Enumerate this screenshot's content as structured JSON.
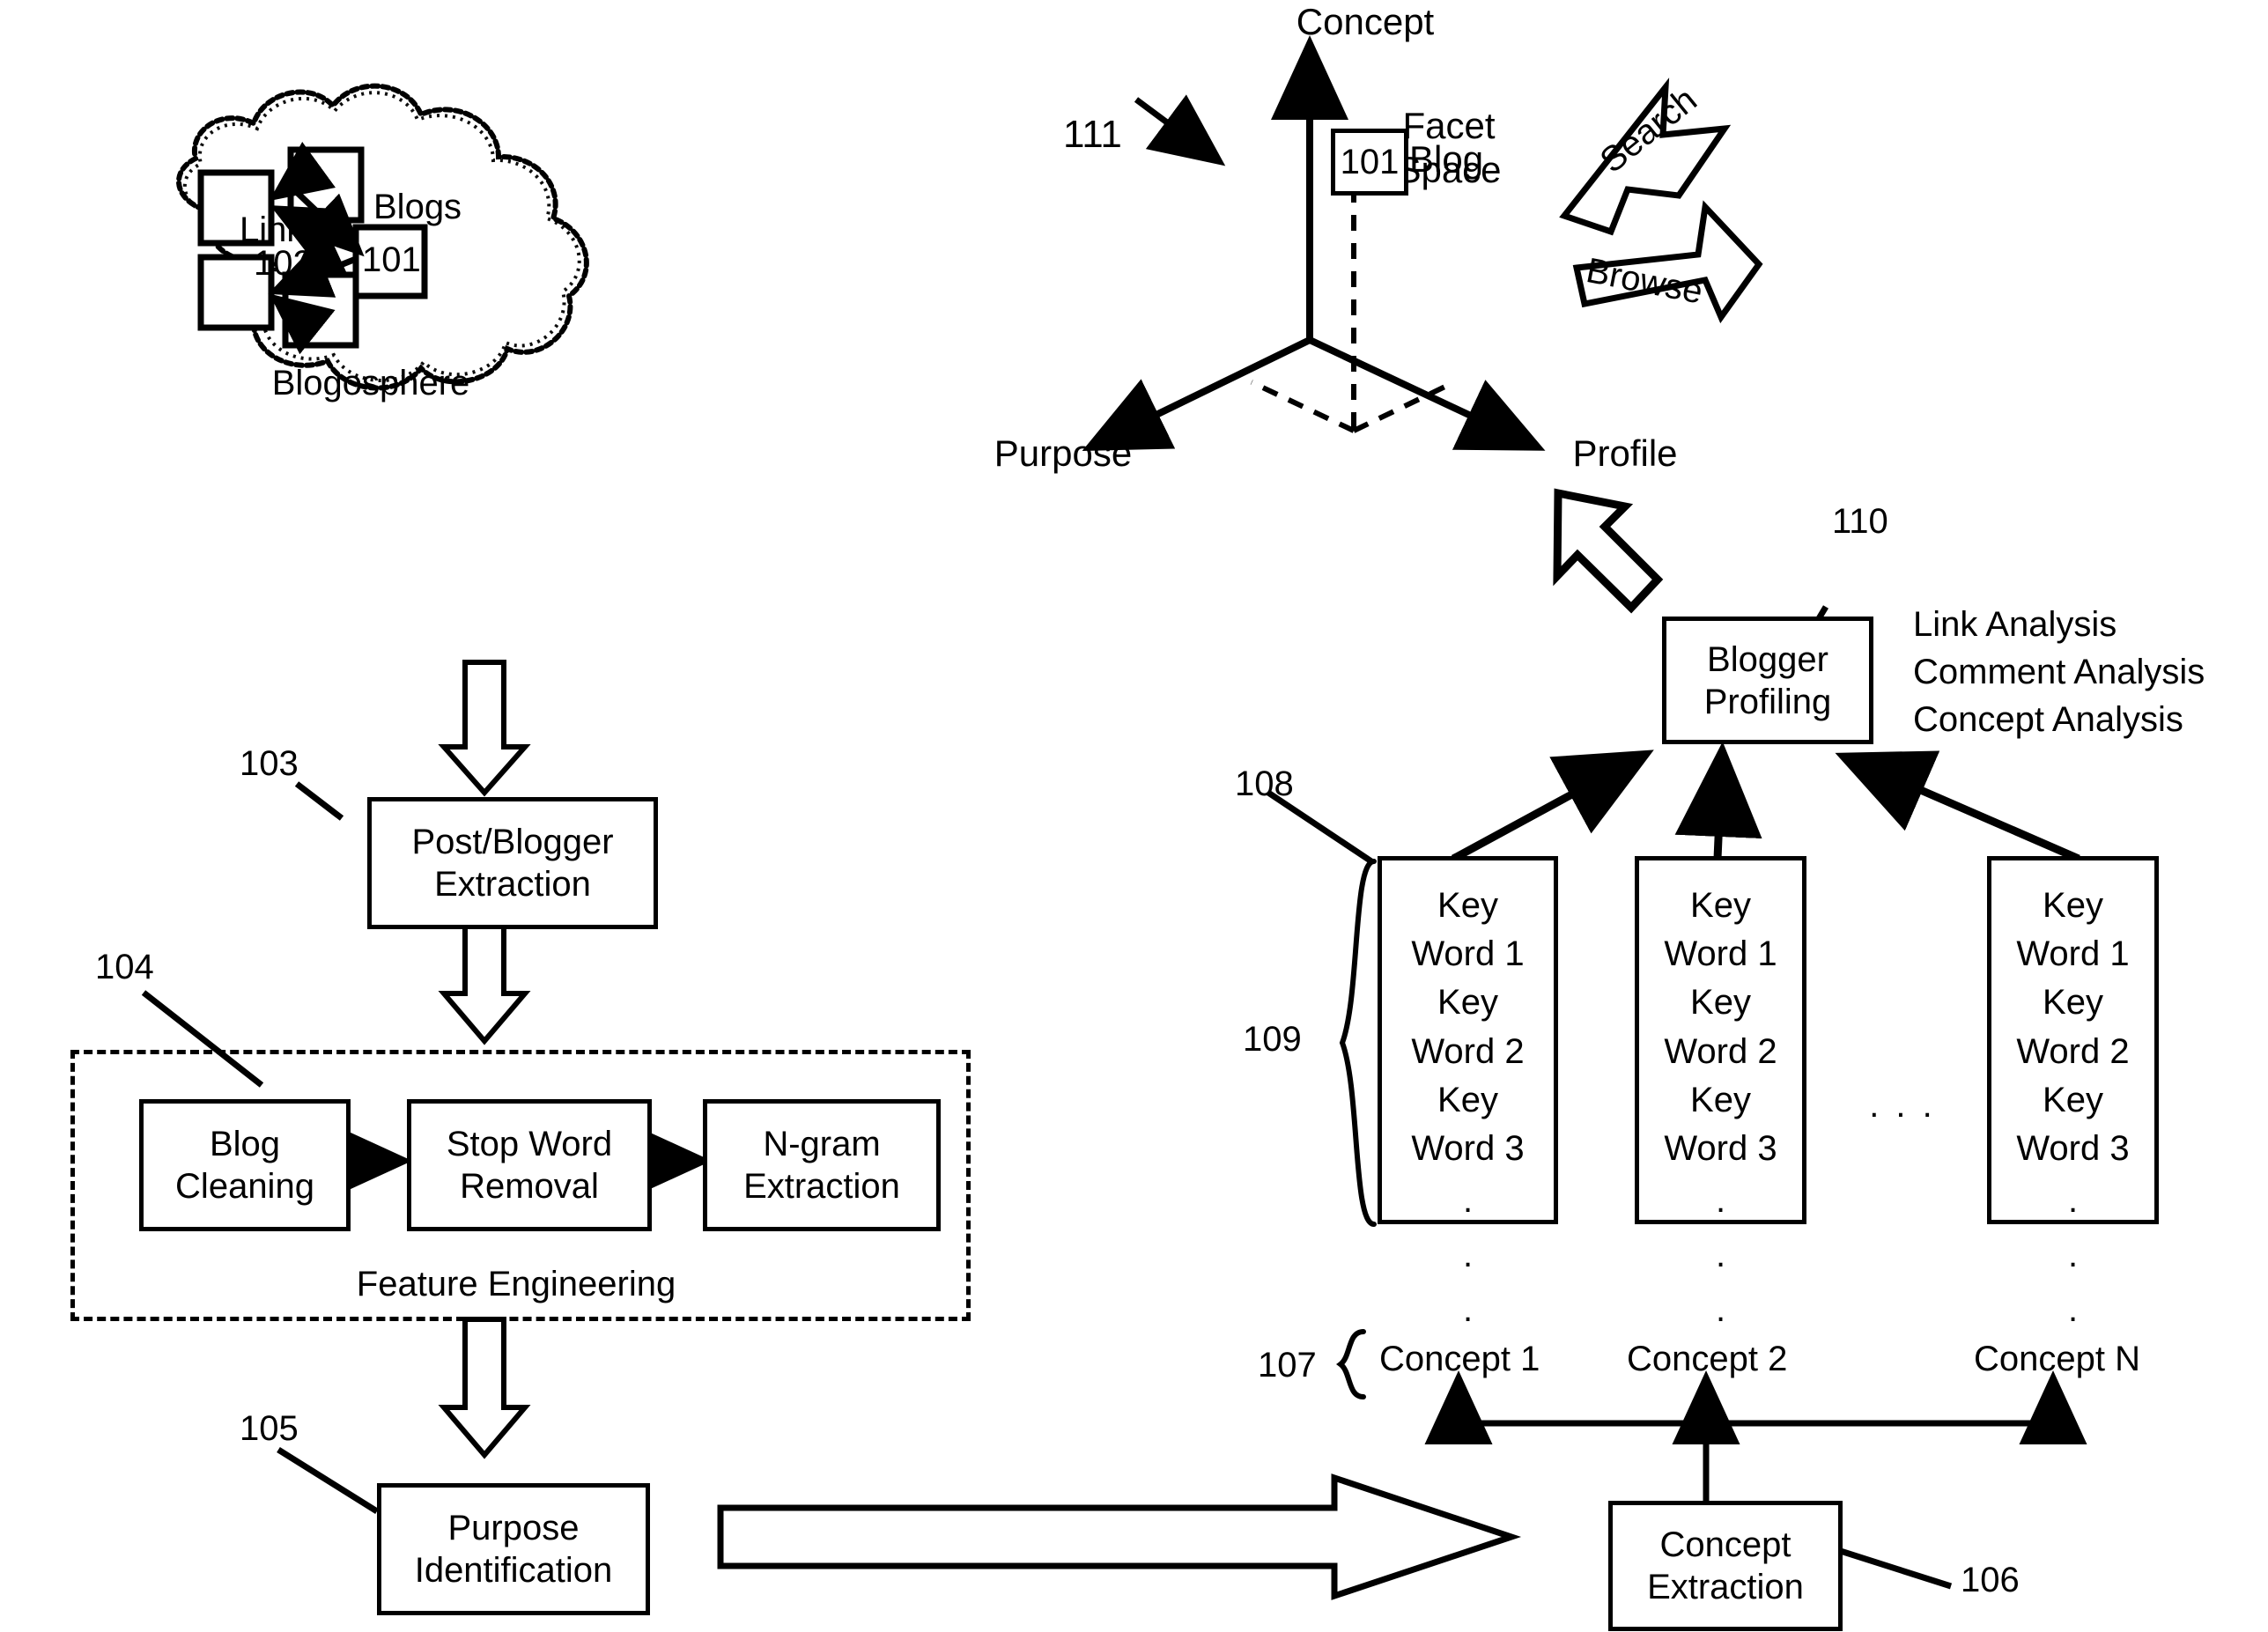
{
  "figure": {
    "type": "patent-flow-diagram",
    "background": "#ffffff",
    "stroke": "#000000"
  },
  "blogosphere": {
    "cloud_label_blogs": "Blogs",
    "cloud_label_links": "Links",
    "links_ref": "102",
    "highlighted_blog_ref": "101",
    "caption": "Blogosphere"
  },
  "pipeline": {
    "post_blogger_extraction": {
      "ref": "103",
      "line1": "Post/Blogger",
      "line2": "Extraction"
    },
    "feature_engineering": {
      "ref": "104",
      "caption": "Feature Engineering",
      "stages": [
        {
          "line1": "Blog",
          "line2": "Cleaning"
        },
        {
          "line1": "Stop Word",
          "line2": "Removal"
        },
        {
          "line1": "N-gram",
          "line2": "Extraction"
        }
      ]
    },
    "purpose_identification": {
      "ref": "105",
      "line1": "Purpose",
      "line2": "Identification"
    },
    "concept_extraction": {
      "ref": "106",
      "line1": "Concept",
      "line2": "Extraction"
    }
  },
  "concepts": {
    "ref": "107",
    "labels": [
      "Concept 1",
      "Concept 2",
      "Concept N"
    ]
  },
  "keyword_columns": {
    "column_ref": "108",
    "list_ref": "109",
    "ellipsis": ". . .",
    "columns": [
      {
        "lines": [
          "Key",
          "Word 1",
          "Key",
          "Word 2",
          "Key",
          "Word 3",
          ".",
          ".",
          "."
        ]
      },
      {
        "lines": [
          "Key",
          "Word 1",
          "Key",
          "Word 2",
          "Key",
          "Word 3",
          ".",
          ".",
          "."
        ]
      },
      {
        "lines": [
          "Key",
          "Word 1",
          "Key",
          "Word 2",
          "Key",
          "Word 3",
          ".",
          ".",
          "."
        ]
      }
    ]
  },
  "blogger_profiling": {
    "ref": "110",
    "line1": "Blogger",
    "line2": "Profiling",
    "analyses": [
      "Link Analysis",
      "Comment Analysis",
      "Concept Analysis"
    ]
  },
  "facet_space": {
    "ref": "111",
    "title_line1": "Facet",
    "title_line2": "Space",
    "axes": {
      "vertical": "Concept",
      "left": "Purpose",
      "right": "Profile"
    },
    "point_ref": "101",
    "point_label": "Blog",
    "actions": [
      "Search",
      "Browse"
    ]
  }
}
